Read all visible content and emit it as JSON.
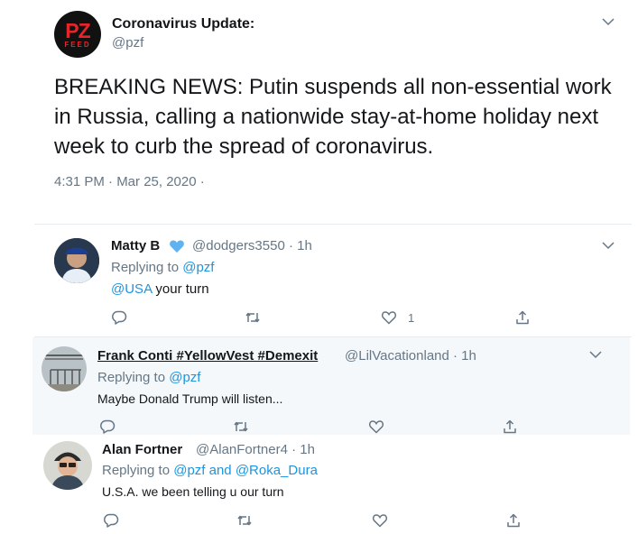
{
  "main_tweet": {
    "avatar_text": "PZ",
    "avatar_subtext": "FEED",
    "display_name": "Coronavirus Update:",
    "handle": "@pzf",
    "text": "BREAKING NEWS: Putin suspends all non-essential work in Russia, calling a nationwide stay-at-home holiday next week to curb the spread of coronavirus.",
    "timestamp": "4:31 PM · Mar 25, 2020 ·"
  },
  "replies": [
    {
      "display_name": "Matty B",
      "badge": "blue-heart-icon",
      "meta": "@dodgers3550 · 1h",
      "replying_prefix": "Replying to",
      "replying_to": "@pzf",
      "mention": "@USA",
      "text": " your turn",
      "like_count": "1"
    },
    {
      "display_name": "Frank Conti #YellowVest #Demexit",
      "meta": "@LilVacationland · 1h",
      "replying_prefix": "Replying to",
      "replying_to": "@pzf",
      "text": "Maybe Donald Trump will listen..."
    },
    {
      "display_name": "Alan Fortner",
      "meta": "@AlanFortner4 · 1h",
      "replying_prefix": "Replying to",
      "replying_to": "@pzf and @Roka_Dura",
      "text": "U.S.A. we been telling u our turn"
    }
  ],
  "colors": {
    "link_blue": "#1b95e0",
    "secondary_gray": "#657786",
    "heart_blue": "#5eb3f0",
    "pz_red": "#e4262b"
  }
}
